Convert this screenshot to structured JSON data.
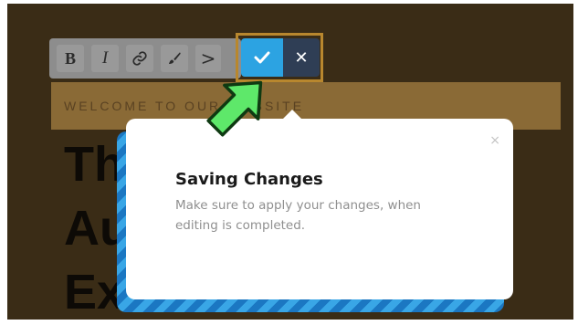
{
  "page": {
    "welcome_banner": "WELCOME TO OUR WEBSITE",
    "headline_lines": [
      "The",
      "Au",
      "Ex"
    ]
  },
  "toolbar": {
    "bold_label": "B",
    "italic_label": "I",
    "link_icon": "link-icon",
    "brush_icon": "brush-icon",
    "more_label": ">",
    "apply_icon": "check-icon",
    "cancel_label": "✕"
  },
  "tooltip": {
    "title": "Saving Changes",
    "body": "Make sure to apply your changes, when editing is completed.",
    "close_label": "×"
  },
  "colors": {
    "apply_button": "#2ca3e2",
    "cancel_button": "#2f3e55",
    "pointer_arrow": "#5ee86a",
    "popover_stripes": "#1b77c2"
  }
}
